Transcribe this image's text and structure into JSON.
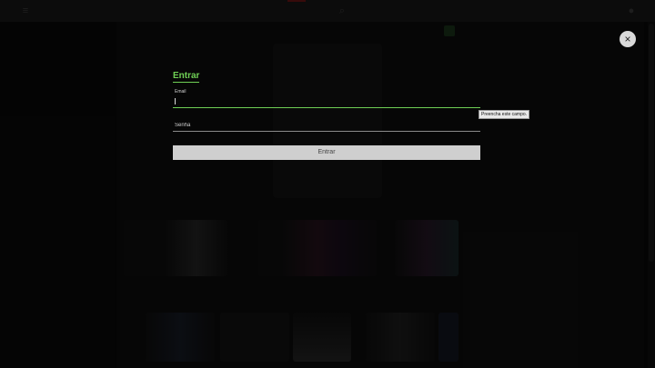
{
  "background": {
    "section_1_title": "",
    "section_2_title": ""
  },
  "modal": {
    "title": "Entrar",
    "email_label": "Email",
    "email_value": "",
    "password_placeholder": "Senha",
    "submit_label": "Entrar",
    "close_symbol": "×",
    "tooltip": "Preencha este campo."
  },
  "colors": {
    "accent": "#6fcf55",
    "button_bg": "#cfcfcf"
  }
}
